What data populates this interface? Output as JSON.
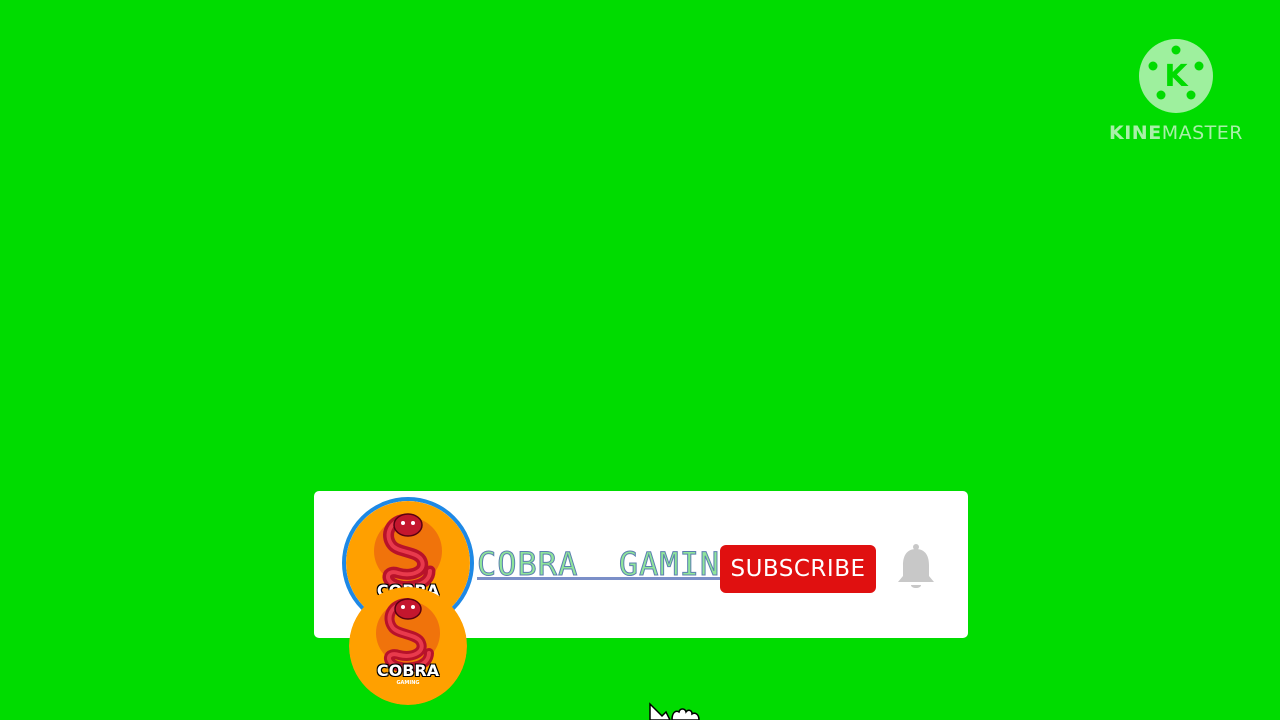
{
  "watermark": {
    "brand_prefix": "KINE",
    "brand_suffix": "MASTER",
    "logo_letter": "K",
    "logo_icon": "kinemaster-logo-icon"
  },
  "card": {
    "avatar": {
      "label": "COBRA",
      "sublabel": "GAMING",
      "icon": "cobra-snake-icon"
    },
    "channel_name": "COBRA  GAMING",
    "subscribe_label": "SUBSCRIBE",
    "bell_icon": "notification-bell-icon"
  },
  "cursor_icon": "hand-pointer-icon",
  "colors": {
    "background": "#00dc00",
    "card": "#ffffff",
    "subscribe": "#e01010",
    "avatar_ring": "#1e88e5",
    "avatar_fill": "#ffa000",
    "snake": "#c4162e",
    "bell": "#c8c8c8"
  }
}
